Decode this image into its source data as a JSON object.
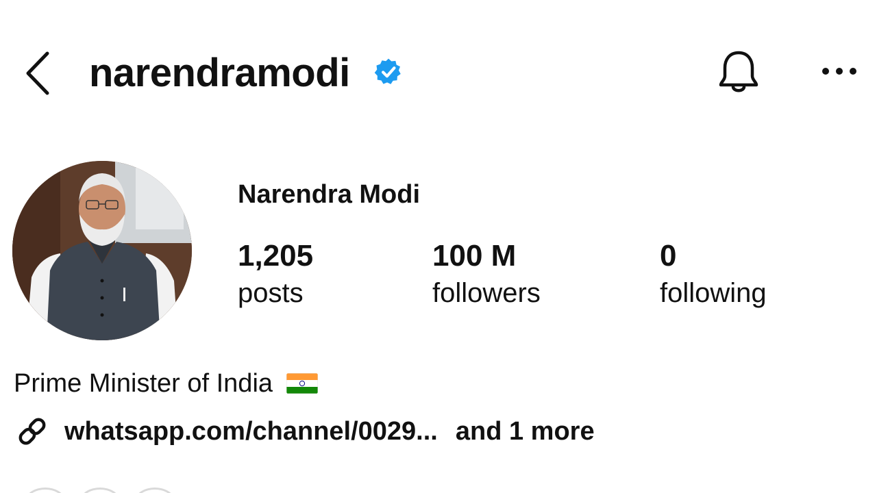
{
  "header": {
    "username": "narendramodi",
    "verified": true,
    "icons": [
      "back-arrow-icon",
      "verified-badge-icon",
      "bell-icon",
      "more-options-icon"
    ]
  },
  "profile": {
    "display_name": "Narendra Modi",
    "stats": [
      {
        "value": "1,205",
        "label": "posts"
      },
      {
        "value": "100 M",
        "label": "followers"
      },
      {
        "value": "0",
        "label": "following"
      }
    ],
    "bio": "Prime Minister of India",
    "bio_emoji": "india-flag",
    "link": "whatsapp.com/channel/0029...",
    "link_more": "and 1 more"
  },
  "colors": {
    "verified": "#1d9bf0",
    "text": "#111111",
    "background": "#ffffff"
  }
}
